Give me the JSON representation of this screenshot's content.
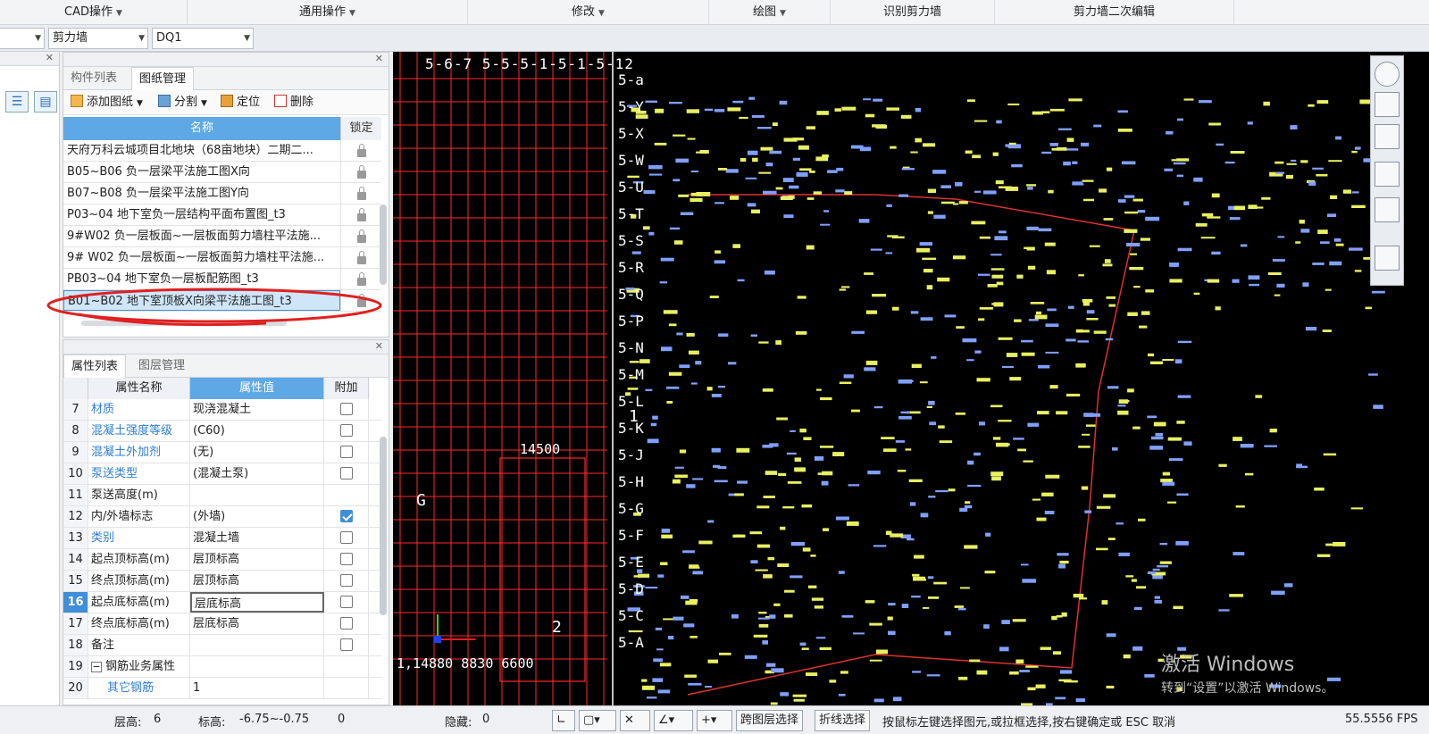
{
  "menubar": {
    "items": [
      {
        "label": "CAD操作"
      },
      {
        "label": "通用操作"
      },
      {
        "label": "修改"
      },
      {
        "label": "绘图"
      },
      {
        "label": "识别剪力墙"
      },
      {
        "label": "剪力墙二次编辑"
      }
    ]
  },
  "selectors": {
    "type_value": "剪力墙",
    "name_value": "DQ1"
  },
  "drawings_panel": {
    "tabs": [
      "构件列表",
      "图纸管理"
    ],
    "toolbar": {
      "add": "添加图纸",
      "split": "分割",
      "locate": "定位",
      "delete": "删除"
    },
    "columns": {
      "name": "名称",
      "lock": "锁定"
    },
    "rows": [
      "天府万科云城项目北地块（68亩地块）二期二...",
      "B05~B06 负一层梁平法施工图X向",
      "B07~B08 负一层梁平法施工图Y向",
      "P03~04 地下室负一层结构平面布置图_t3",
      "9#W02 负一层板面~一层板面剪力墙柱平法施...",
      "9# W02 负一层板面~一层板面剪力墙柱平法施...",
      "PB03~04 地下室负一层板配筋图_t3",
      "B01~B02 地下室顶板X向梁平法施工图_t3"
    ],
    "selected_index": 7
  },
  "properties_panel": {
    "tabs": [
      "属性列表",
      "图层管理"
    ],
    "columns": {
      "name": "属性名称",
      "value": "属性值",
      "extra": "附加"
    },
    "rows": [
      {
        "n": "7",
        "name": "材质",
        "value": "现浇混凝土",
        "blue": true,
        "check": false
      },
      {
        "n": "8",
        "name": "混凝土强度等级",
        "value": "(C60)",
        "blue": true,
        "check": false
      },
      {
        "n": "9",
        "name": "混凝土外加剂",
        "value": "(无)",
        "blue": true,
        "check": false
      },
      {
        "n": "10",
        "name": "泵送类型",
        "value": "(混凝土泵)",
        "blue": true,
        "check": false
      },
      {
        "n": "11",
        "name": "泵送高度(m)",
        "value": "",
        "blue": false,
        "check": null
      },
      {
        "n": "12",
        "name": "内/外墙标志",
        "value": "(外墙)",
        "blue": false,
        "check": true
      },
      {
        "n": "13",
        "name": "类别",
        "value": "混凝土墙",
        "blue": true,
        "check": false
      },
      {
        "n": "14",
        "name": "起点顶标高(m)",
        "value": "层顶标高",
        "blue": false,
        "check": false
      },
      {
        "n": "15",
        "name": "终点顶标高(m)",
        "value": "层顶标高",
        "blue": false,
        "check": false
      },
      {
        "n": "16",
        "name": "起点底标高(m)",
        "value": "层底标高",
        "blue": false,
        "check": false
      },
      {
        "n": "17",
        "name": "终点底标高(m)",
        "value": "层底标高",
        "blue": false,
        "check": false
      },
      {
        "n": "18",
        "name": "备注",
        "value": "",
        "blue": false,
        "check": false
      },
      {
        "n": "19",
        "name": "钢筋业务属性",
        "value": "",
        "blue": false,
        "check": null
      },
      {
        "n": "20",
        "name": "其它钢筋",
        "value": "1",
        "blue": true,
        "check": null
      }
    ],
    "active_row": "16"
  },
  "canvas": {
    "grid_labels_top": "5-6-7  5-5-5-1-5-1-5-12",
    "grid_labels_axis": [
      "5-a",
      "5-Y",
      "5-X",
      "5-W",
      "5-U",
      "5-T",
      "5-S",
      "5-R",
      "5-Q",
      "5-P",
      "5-N",
      "5-M",
      "5-L",
      "5-K",
      "5-J",
      "5-H",
      "5-G",
      "5-F",
      "5-E",
      "5-D",
      "5-C",
      "5-A"
    ],
    "label_g": "G",
    "label_2": "2",
    "label_1": "1",
    "dim_14500": "14500",
    "bottom_dims": "1,14880 8830 6600"
  },
  "activation": {
    "line1": "激活 Windows",
    "line2": "转到“设置”以激活 Windows。"
  },
  "status": {
    "floor_height_label": "层高:",
    "floor_height_value": "6",
    "elevation_label": "标高:",
    "elevation_value": "-6.75~-0.75",
    "zero": "0",
    "hidden_label": "隐藏:",
    "hidden_value": "0",
    "cross_layer_btn": "跨图层选择",
    "polyline_btn": "折线选择",
    "hint": "按鼠标左键选择图元,或拉框选择,按右键确定或 ESC 取消",
    "fps": "55.5556 FPS"
  },
  "colors": {
    "accent": "#5ea8e6",
    "canvas_bg": "#000000",
    "grid_red": "#ff2a2a",
    "yellow": "#e8f060",
    "blue": "#7fa0ff",
    "annotation_red": "#e02020"
  }
}
